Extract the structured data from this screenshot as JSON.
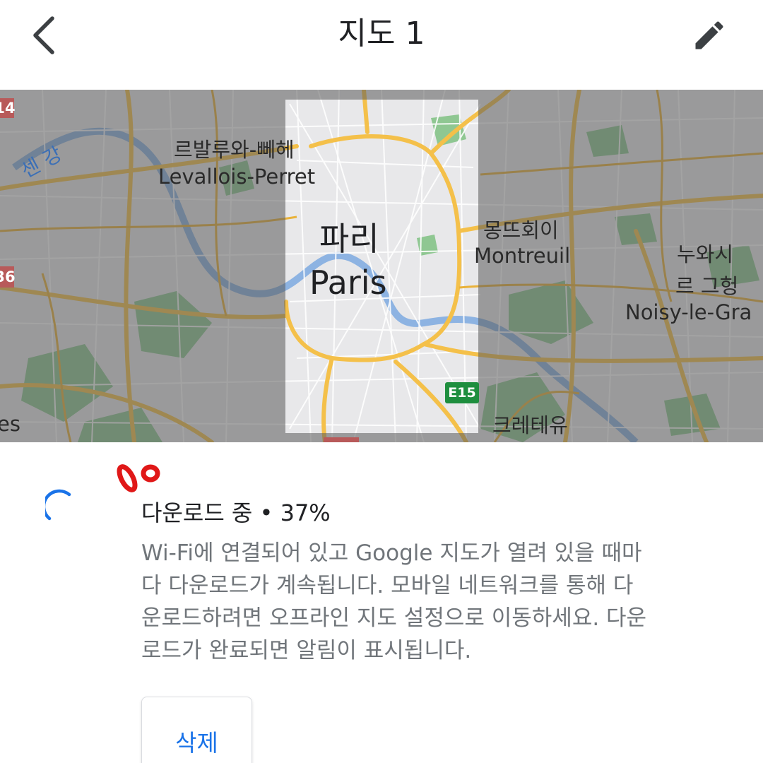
{
  "header": {
    "title": "지도 1",
    "back_icon": "chevron-left-icon",
    "edit_icon": "pencil-icon"
  },
  "map": {
    "labels": {
      "seine": "센 강",
      "levallois_ko": "르발루와-뻬헤",
      "levallois_en": "Levallois-Perret",
      "paris_ko": "파리",
      "paris_en": "Paris",
      "montreuil_ko": "몽뜨회이",
      "montreuil_en": "Montreuil",
      "noisy_ko_1": "누와시",
      "noisy_ko_2": "르 그헝",
      "noisy_en": "Noisy-le-Gra",
      "creteil_ko": "크레테유",
      "route_e15": "E15",
      "edge_shield_top": "14",
      "edge_shield_mid": "36",
      "edge_left_es": "es"
    }
  },
  "download": {
    "status": "다운로드 중 • 37%",
    "progress_percent": 37,
    "description_lines": [
      "Wi-Fi에 연결되어 있고 Google 지도가 열려 있을 때마",
      "다 다운로드가 계속됩니다. 모바일 네트워크를 통해 다",
      "운로드하려면 오프라인 지도 설정으로 이동하세요. 다운",
      "로드가 완료되면 알림이 표시됩니다."
    ],
    "delete_label": "삭제"
  },
  "colors": {
    "accent_blue": "#1a73e8",
    "text_primary": "#202124",
    "text_secondary": "#70757a",
    "map_road": "#f4c04a",
    "map_park": "#5e9c63",
    "annotation_red": "#e01818"
  }
}
